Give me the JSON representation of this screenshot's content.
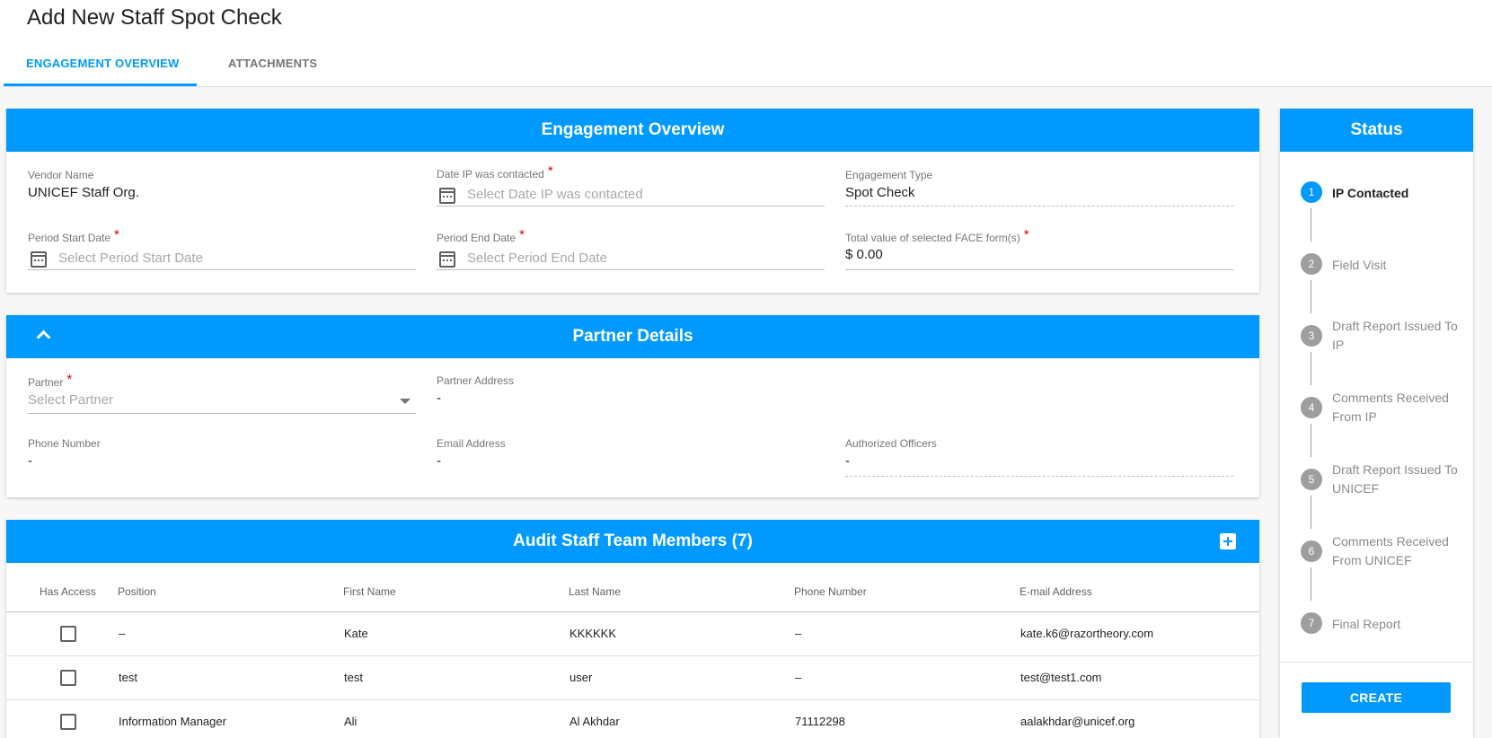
{
  "page": {
    "title": "Add New Staff Spot Check"
  },
  "tabs": [
    {
      "label": "ENGAGEMENT OVERVIEW",
      "active": true
    },
    {
      "label": "ATTACHMENTS",
      "active": false
    }
  ],
  "engagement": {
    "title": "Engagement Overview",
    "vendor_name": {
      "label": "Vendor Name",
      "value": "UNICEF Staff Org."
    },
    "date_contacted": {
      "label": "Date IP was contacted",
      "required": "*",
      "placeholder": "Select Date IP was contacted"
    },
    "engagement_type": {
      "label": "Engagement Type",
      "value": "Spot Check"
    },
    "period_start": {
      "label": "Period Start Date",
      "required": "*",
      "placeholder": "Select Period Start Date"
    },
    "period_end": {
      "label": "Period End Date",
      "required": "*",
      "placeholder": "Select Period End Date"
    },
    "face_total": {
      "label": "Total value of selected FACE form(s)",
      "required": "*",
      "currency": "$",
      "value": "0.00"
    }
  },
  "partner": {
    "title": "Partner Details",
    "partner": {
      "label": "Partner",
      "required": "*",
      "placeholder": "Select Partner"
    },
    "address": {
      "label": "Partner Address",
      "value": "-"
    },
    "phone": {
      "label": "Phone Number",
      "value": "-"
    },
    "email": {
      "label": "Email Address",
      "value": "-"
    },
    "officers": {
      "label": "Authorized Officers",
      "value": "-"
    }
  },
  "team": {
    "title": "Audit Staff Team Members (7)",
    "columns": [
      "Has Access",
      "Position",
      "First Name",
      "Last Name",
      "Phone Number",
      "E-mail Address"
    ],
    "rows": [
      {
        "position": "–",
        "first": "Kate",
        "last": "KKKKKK",
        "phone": "–",
        "email": "kate.k6@razortheory.com"
      },
      {
        "position": "test",
        "first": "test",
        "last": "user",
        "phone": "–",
        "email": "test@test1.com"
      },
      {
        "position": "Information Manager",
        "first": "Ali",
        "last": "Al Akhdar",
        "phone": "71112298",
        "email": "aalakhdar@unicef.org"
      }
    ]
  },
  "status": {
    "title": "Status",
    "steps": [
      {
        "num": "1",
        "label": "IP Contacted",
        "active": true
      },
      {
        "num": "2",
        "label": "Field Visit",
        "active": false
      },
      {
        "num": "3",
        "label": "Draft Report Issued To IP",
        "active": false
      },
      {
        "num": "4",
        "label": "Comments Received From IP",
        "active": false
      },
      {
        "num": "5",
        "label": "Draft Report Issued To UNICEF",
        "active": false
      },
      {
        "num": "6",
        "label": "Comments Received From UNICEF",
        "active": false
      },
      {
        "num": "7",
        "label": "Final Report",
        "active": false
      }
    ],
    "create_label": "CREATE"
  },
  "colors": {
    "accent": "#0099ff",
    "required": "#d50000",
    "step_inactive": "#9e9e9e"
  }
}
